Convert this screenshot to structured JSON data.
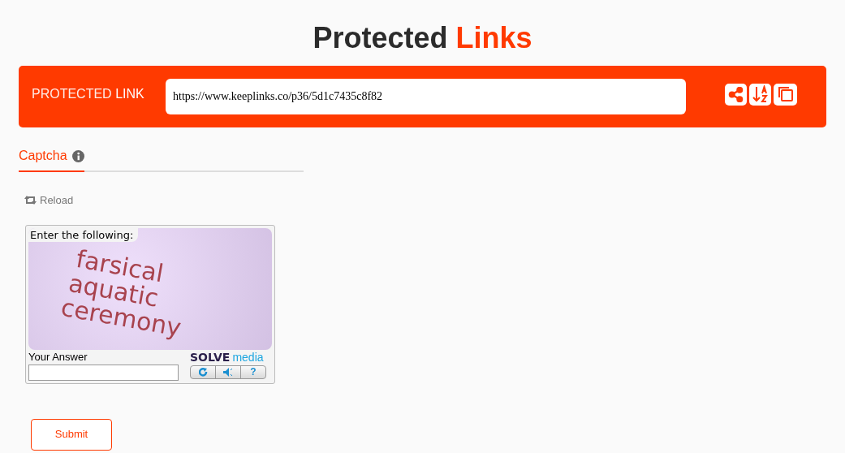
{
  "title": {
    "plain": "Protected",
    "accent": "Links"
  },
  "link_bar": {
    "label_light": "PROTECTED",
    "label_bold": "LINK",
    "url": "https://www.keeplinks.co/p36/5d1c7435c8f82"
  },
  "tabs": [
    {
      "label": "Captcha",
      "selected": true
    }
  ],
  "reload": "Reload",
  "captcha": {
    "prompt": "Enter the following:",
    "words": [
      "farsical",
      "aquatic",
      "ceremony"
    ],
    "answer_label": "Your Answer",
    "logo_a": "SOLVE",
    "logo_b": "media",
    "help": "?"
  },
  "submit": "Submit"
}
